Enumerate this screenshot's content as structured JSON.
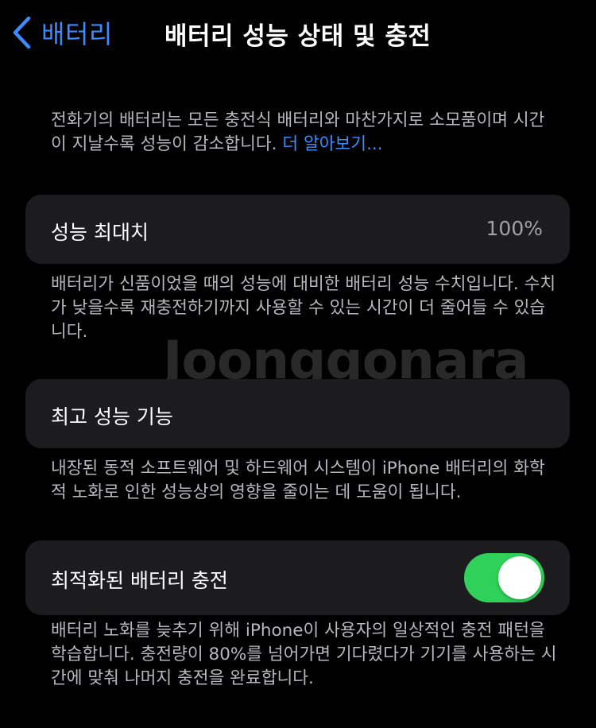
{
  "nav": {
    "back_label": "배터리",
    "title": "배터리 성능 상태 및 충전"
  },
  "intro": {
    "text": "전화기의 배터리는 모든 충전식 배터리와 마찬가지로 소모품이며 시간이 지날수록 성능이 감소합니다.",
    "link": "더 알아보기..."
  },
  "max_capacity": {
    "label": "성능 최대치",
    "value": "100%",
    "footnote": "배터리가 신품이었을 때의 성능에 대비한 배터리 성능 수치입니다. 수치가 낮을수록 재충전하기까지 사용할 수 있는 시간이 더 줄어들 수 있습니다."
  },
  "peak_performance": {
    "label": "최고 성능 기능",
    "footnote": "내장된 동적 소프트웨어 및 하드웨어 시스템이 iPhone 배터리의 화학적 노화로 인한 성능상의 영향을 줄이는 데 도움이 됩니다."
  },
  "optimized_charging": {
    "label": "최적화된 배터리 충전",
    "enabled": true,
    "footnote": "배터리 노화를 늦추기 위해 iPhone이 사용자의 일상적인 충전 패턴을 학습합니다. 충전량이 80%를 넘어가면 기다렸다가 기기를 사용하는 시간에 맞춰 나머지 충전을 완료합니다."
  },
  "watermark": "Joonggonara",
  "colors": {
    "accent": "#3d8bff",
    "toggle_on": "#30d158",
    "card": "#1c1c1e",
    "background": "#000000"
  }
}
